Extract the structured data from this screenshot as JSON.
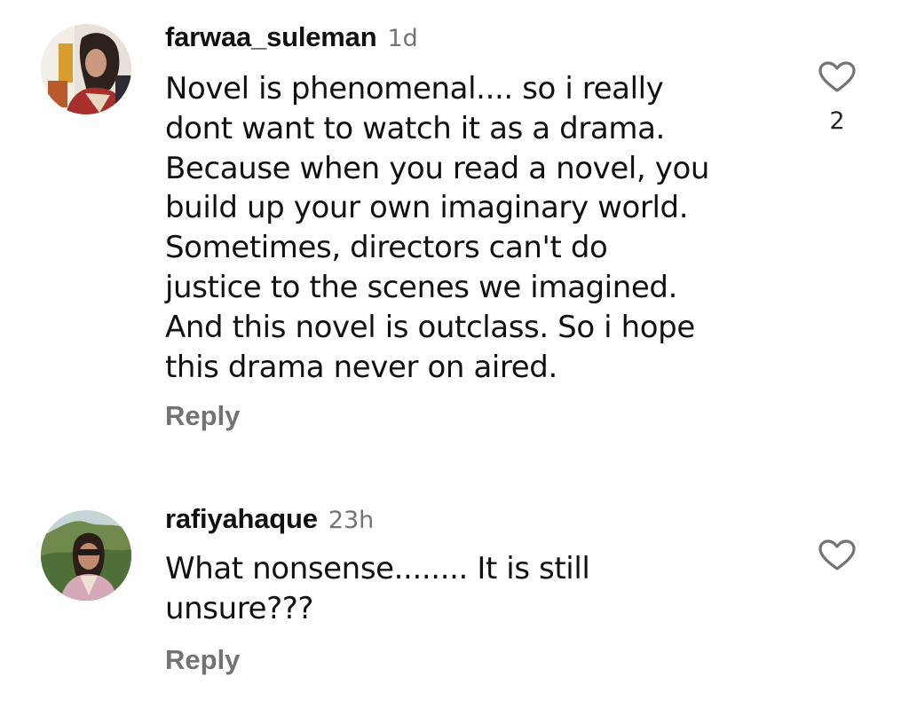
{
  "comments": [
    {
      "username": "farwaa_suleman",
      "timestamp": "1d",
      "text": "Novel is phenomenal.... so i really\ndont want to watch it as a drama.\nBecause when you read a novel, you\nbuild up your own imaginary  world.\nSometimes, directors can't do\njustice to the scenes we imagined.\nAnd this novel is outclass. So i hope\nthis drama never on aired.",
      "reply_label": "Reply",
      "like_count": "2",
      "like_icon": "heart-outline-icon"
    },
    {
      "username": "rafiyahaque",
      "timestamp": "23h",
      "text": "What nonsense........ It is still\nunsure???",
      "reply_label": "Reply",
      "like_icon": "heart-outline-icon"
    }
  ],
  "colors": {
    "text_primary": "#111111",
    "text_secondary": "#737373",
    "like_count": "#262626",
    "background": "#ffffff"
  }
}
